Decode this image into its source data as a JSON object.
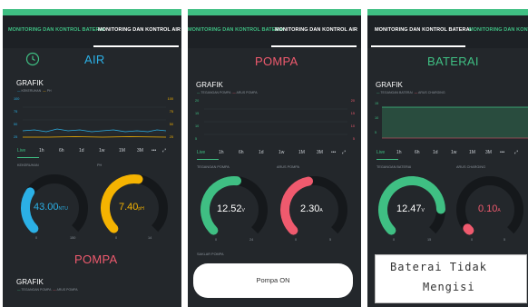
{
  "tabs": {
    "bat": "MONITORING DAN KONTROL BATERAI",
    "air": "MONITORING DAN KONTROL AIR"
  },
  "panel1": {
    "title": "AIR",
    "grafik": "GRAFIK",
    "legend": [
      "KEKERUHAN",
      "PH"
    ],
    "left_axis": [
      "100",
      "75",
      "50",
      "25"
    ],
    "right_axis": [
      "100",
      "75",
      "50",
      "25"
    ],
    "time_ranges": [
      "Live",
      "1h",
      "6h",
      "1d",
      "1w",
      "1M",
      "3M"
    ],
    "gauge1": {
      "label": "KEKERUHAN",
      "value": "43.00",
      "unit": "NTU",
      "min": "0",
      "max": "150",
      "fraction": 0.29
    },
    "gauge2": {
      "label": "PH",
      "value": "7.40",
      "unit": "pH",
      "min": "0",
      "max": "14",
      "fraction": 0.53
    },
    "section2_title": "POMPA",
    "grafik2": "GRAFIK",
    "legend2": [
      "TEGANGAN POMPA",
      "ARUS POMPA"
    ]
  },
  "panel2": {
    "title": "POMPA",
    "grafik": "GRAFIK",
    "legend": [
      "TEGANGAN POMPA",
      "ARUS POMPA"
    ],
    "left_axis": [
      "20",
      "15",
      "10",
      "5"
    ],
    "right_axis": [
      "20",
      "15",
      "10",
      "5"
    ],
    "time_ranges": [
      "Live",
      "1h",
      "6h",
      "1d",
      "1w",
      "1M",
      "3M"
    ],
    "gauge1": {
      "label": "TEGANGAN POMPA",
      "value": "12.52",
      "unit": "V",
      "min": "0",
      "max": "24",
      "fraction": 0.52
    },
    "gauge2": {
      "label": "ARUS POMPA",
      "value": "2.30",
      "unit": "A",
      "min": "0",
      "max": "5",
      "fraction": 0.46
    },
    "status_label": "SAKLAR POMPA",
    "button": "Pompa ON"
  },
  "panel3": {
    "title": "BATERAI",
    "grafik": "GRAFIK",
    "legend": [
      "TEGANGAN BATERAI",
      "ARUS CHARGING"
    ],
    "left_axis": [
      "15",
      "10",
      "5"
    ],
    "time_ranges": [
      "Live",
      "1h",
      "6h",
      "1d",
      "1w",
      "1M",
      "3M"
    ],
    "gauge1": {
      "label": "TEGANGAN BATERAI",
      "value": "12.47",
      "unit": "V",
      "min": "0",
      "max": "15",
      "fraction": 0.83
    },
    "gauge2": {
      "label": "ARUS CHARGING",
      "value": "0.10",
      "unit": "A",
      "min": "0",
      "max": "5",
      "fraction": 0.02
    },
    "lcd_line1": "Baterai Tidak",
    "lcd_line2": "Mengisi"
  },
  "colors": {
    "green": "#3fbf83",
    "blue": "#2bb0e6",
    "yellow": "#f5b301",
    "red": "#ef5a6e",
    "track": "#15181b"
  },
  "icons": [
    "clock-icon",
    "more-icon",
    "expand-icon"
  ]
}
